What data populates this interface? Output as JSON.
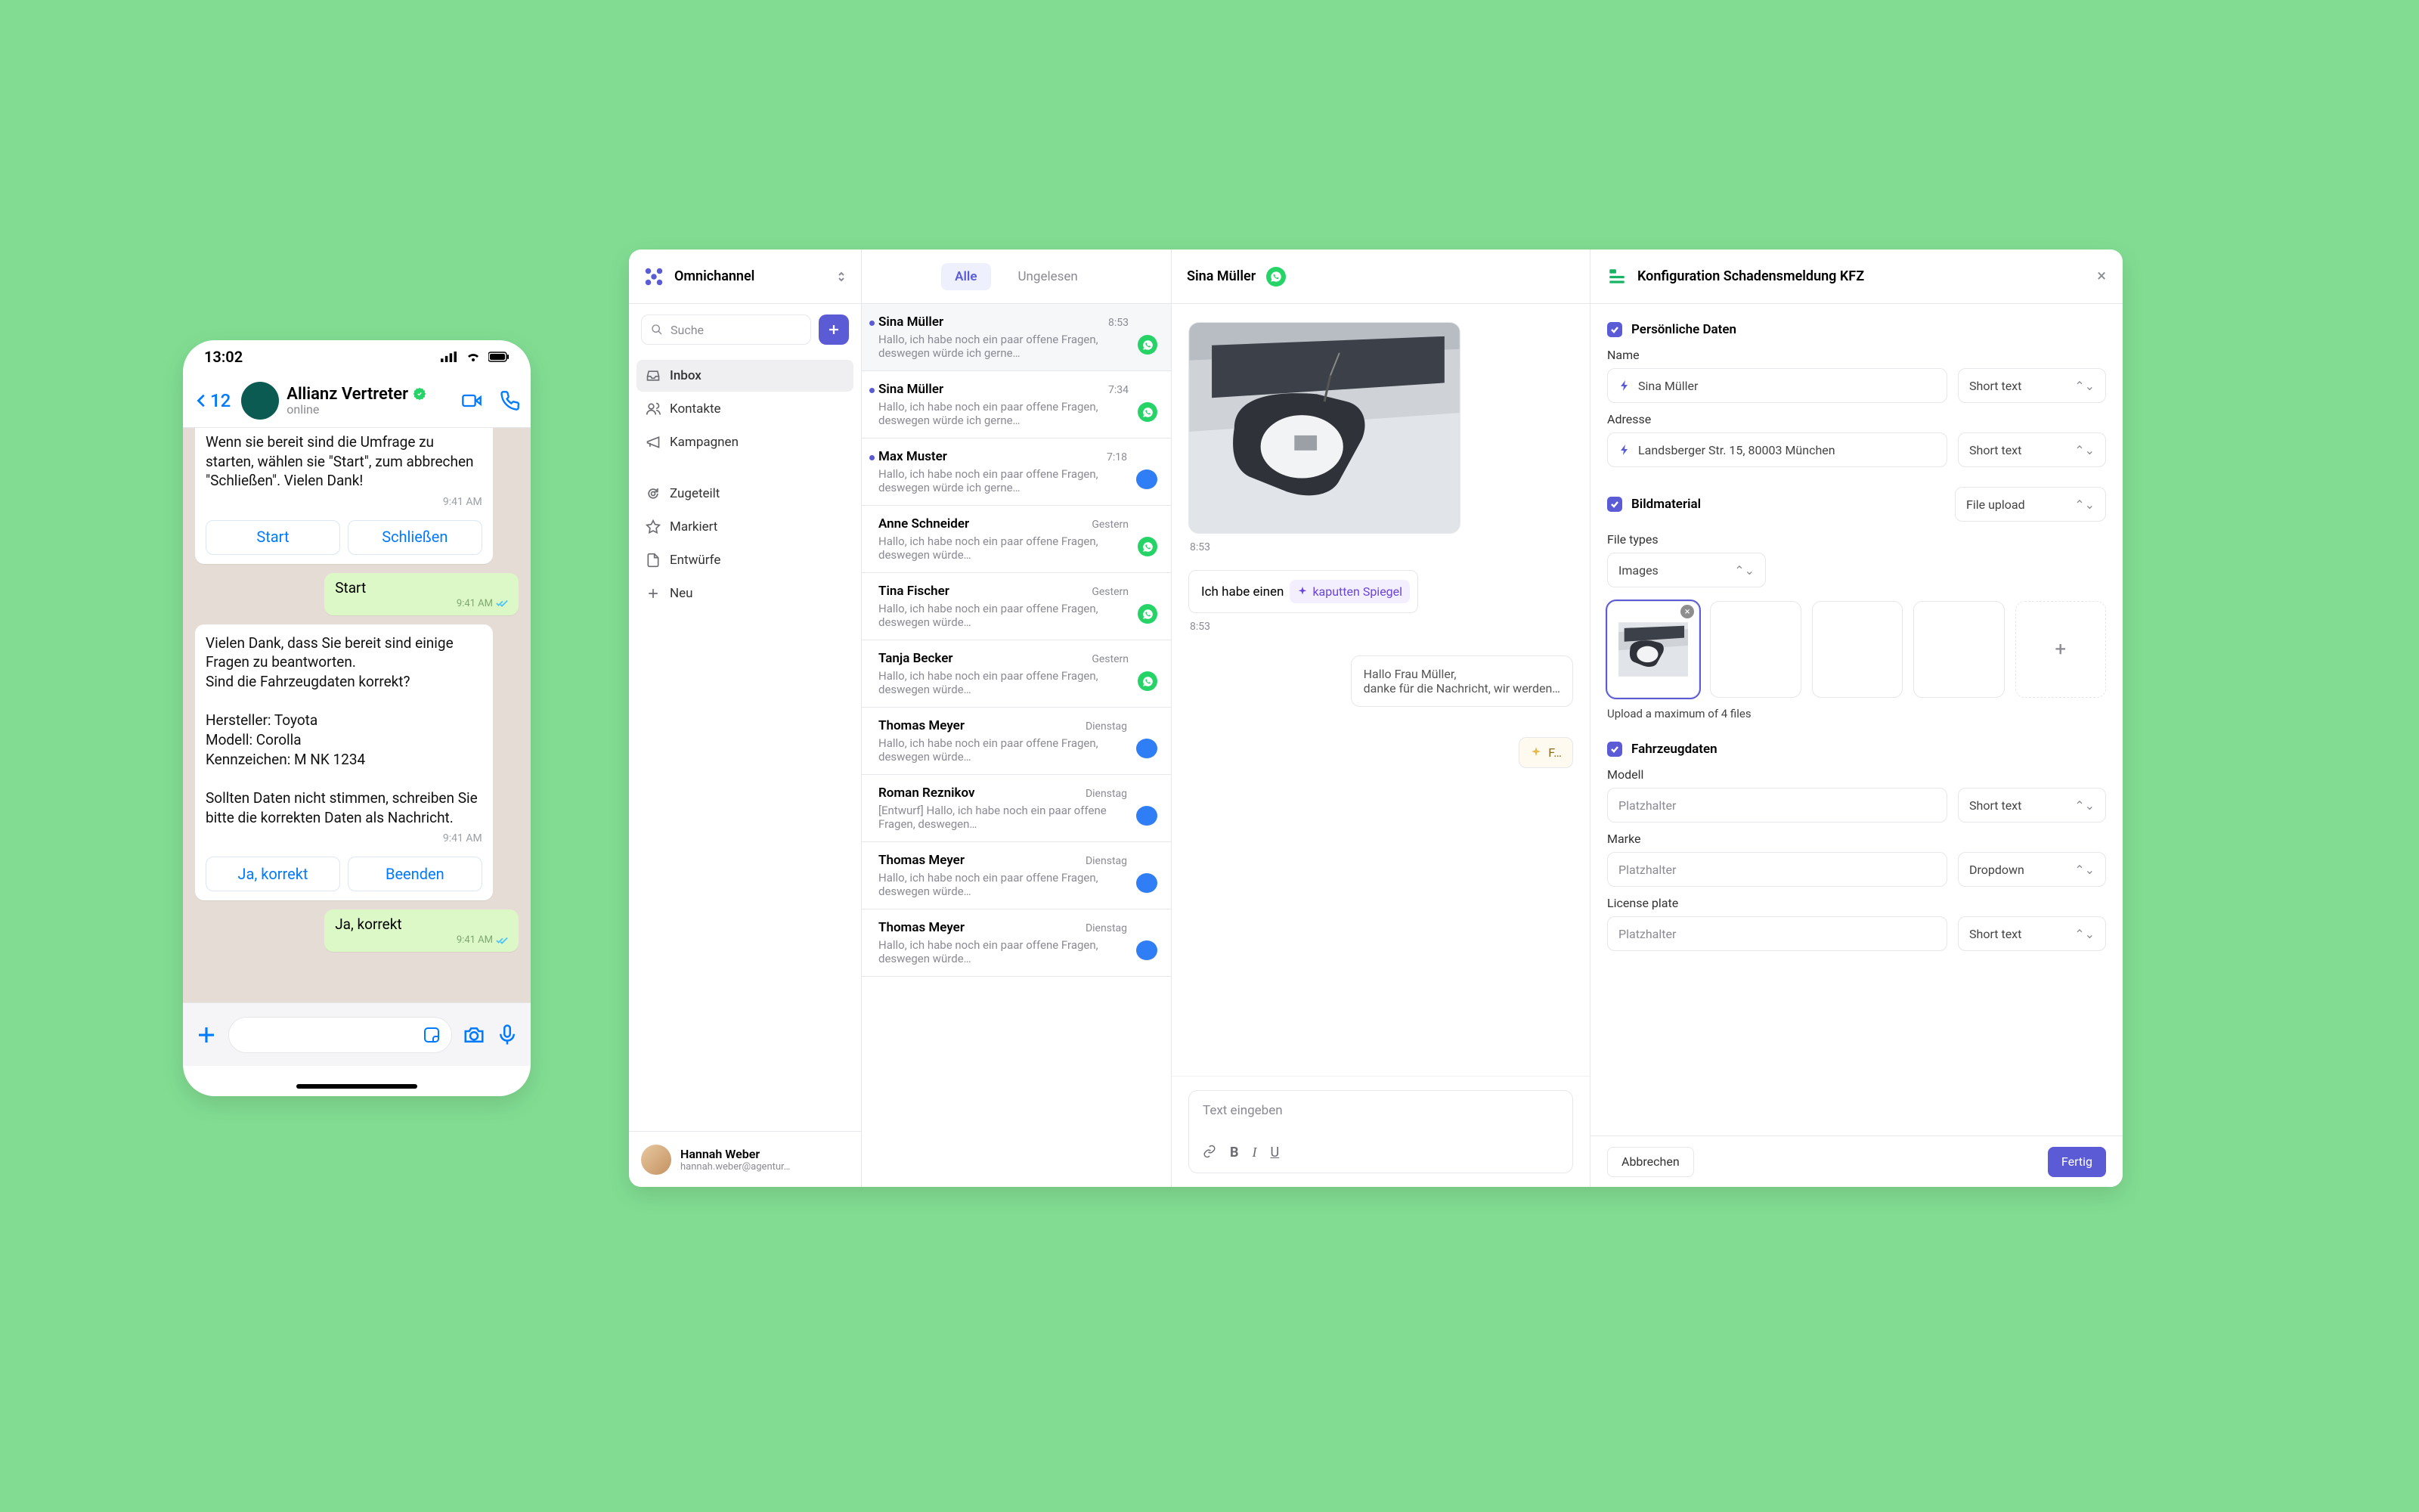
{
  "phone": {
    "clock": "13:02",
    "back_count": "12",
    "contact_name": "Allianz Vertreter",
    "status": "online",
    "m1_text": "Wenn sie bereit sind die Umfrage zu starten, wählen sie \"Start\", zum abbrechen \"Schließen\". Vielen Dank!",
    "m1_time": "9:41 AM",
    "btn_start": "Start",
    "btn_close": "Schließen",
    "r1_text": "Start",
    "r1_time": "9:41 AM",
    "m2_text": "Vielen Dank, dass Sie bereit sind einige Fragen zu beantworten.\nSind die Fahrzeugdaten korrekt?\n\nHersteller: Toyota\nModell: Corolla\nKennzeichen: M NK 1234\n\nSollten Daten nicht stimmen, schreiben Sie bitte die korrekten Daten als Nachricht.",
    "m2_time": "9:41 AM",
    "btn_yes": "Ja, korrekt",
    "btn_end": "Beenden",
    "r2_text": "Ja, korrekt",
    "r2_time": "9:41 AM"
  },
  "sidebar": {
    "workspace": "Omnichannel",
    "search_ph": "Suche",
    "nav": {
      "inbox": "Inbox",
      "contacts": "Kontakte",
      "campaigns": "Kampagnen",
      "assigned": "Zugeteilt",
      "marked": "Markiert",
      "drafts": "Entwürfe",
      "new": "Neu"
    },
    "user_name": "Hannah Weber",
    "user_mail": "hannah.weber@agentur…"
  },
  "tabs": {
    "all": "Alle",
    "unread": "Ungelesen"
  },
  "convs": [
    {
      "name": "Sina Müller",
      "preview": "Hallo, ich habe noch ein paar offene Fragen, deswegen würde ich gerne…",
      "date": "8:53",
      "chan": "wa",
      "unread": true,
      "active": true
    },
    {
      "name": "Sina Müller",
      "preview": "Hallo, ich habe noch ein paar offene Fragen, deswegen würde ich gerne…",
      "date": "7:34",
      "chan": "wa",
      "unread": true
    },
    {
      "name": "Max Muster",
      "preview": "Hallo, ich habe noch ein paar offene Fragen, deswegen würde ich gerne…",
      "date": "7:18",
      "chan": "msg",
      "unread": true
    },
    {
      "name": "Anne Schneider",
      "preview": "Hallo, ich habe noch ein paar offene Fragen, deswegen würde…",
      "date": "Gestern",
      "chan": "wa"
    },
    {
      "name": "Tina Fischer",
      "preview": "Hallo, ich habe noch ein paar offene Fragen, deswegen würde…",
      "date": "Gestern",
      "chan": "wa"
    },
    {
      "name": "Tanja Becker",
      "preview": "Hallo, ich habe noch ein paar offene Fragen, deswegen würde…",
      "date": "Gestern",
      "chan": "wa"
    },
    {
      "name": "Thomas Meyer",
      "preview": "Hallo, ich habe noch ein paar offene Fragen, deswegen würde…",
      "date": "Dienstag",
      "chan": "msg"
    },
    {
      "name": "Roman Reznikov",
      "preview": "[Entwurf] Hallo, ich habe noch ein paar offene Fragen, deswegen…",
      "date": "Dienstag",
      "chan": "msg"
    },
    {
      "name": "Thomas Meyer",
      "preview": "Hallo, ich habe noch ein paar offene Fragen, deswegen würde…",
      "date": "Dienstag",
      "chan": "msg"
    },
    {
      "name": "Thomas Meyer",
      "preview": "Hallo, ich habe noch ein paar offene Fragen, deswegen würde…",
      "date": "Dienstag",
      "chan": "msg"
    }
  ],
  "thread": {
    "peer": "Sina Müller",
    "img_time": "8:53",
    "bubble_pre": "Ich habe einen",
    "bubble_chip": "kaputten Spiegel",
    "bubble_time": "8:53",
    "agent_line1": "Hallo Frau Müller,",
    "agent_line2": "danke für die Nachricht, wir werden…",
    "flow_label": "F…",
    "compose_ph": "Text eingeben"
  },
  "panel": {
    "title": "Konfiguration Schadensmeldung KFZ",
    "s1": "Persönliche Daten",
    "name_lbl": "Name",
    "name_val": "Sina Müller",
    "addr_lbl": "Adresse",
    "addr_val": "Landsberger Str. 15, 80003 München",
    "type_short": "Short text",
    "s2": "Bildmaterial",
    "file_upload": "File upload",
    "filetypes_lbl": "File types",
    "filetypes_val": "Images",
    "hint": "Upload a maximum of 4 files",
    "s3": "Fahrzeugdaten",
    "model_lbl": "Modell",
    "brand_lbl": "Marke",
    "plate_lbl": "License plate",
    "placeholder": "Platzhalter",
    "type_dd": "Dropdown",
    "cancel": "Abbrechen",
    "done": "Fertig"
  }
}
